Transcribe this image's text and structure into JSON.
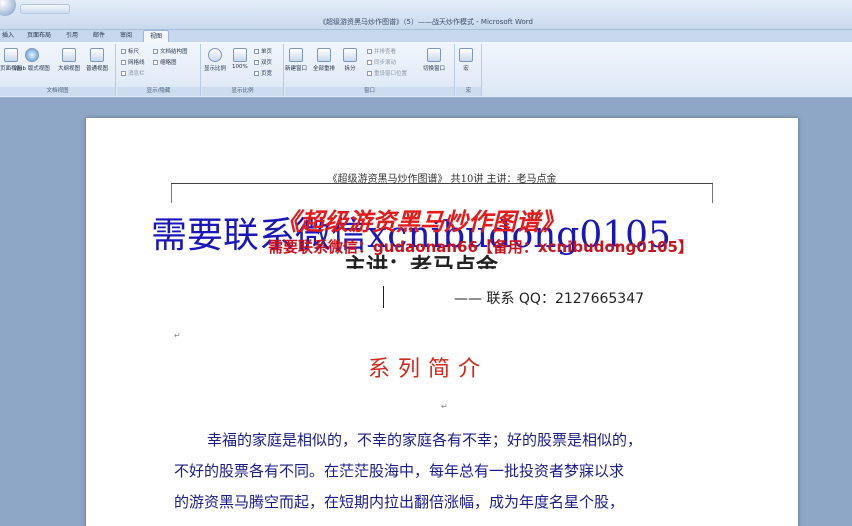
{
  "window": {
    "title": "《超级游资黑马炒作图谱》（5）——战天炒作模式 - Microsoft Word"
  },
  "tabs": [
    {
      "label": "插入"
    },
    {
      "label": "页面布局"
    },
    {
      "label": "引用"
    },
    {
      "label": "邮件"
    },
    {
      "label": "审阅"
    },
    {
      "label": "视图",
      "active": true
    }
  ],
  "ribbon": {
    "doc_views": {
      "label": "文档视图",
      "items": [
        "页面视图",
        "Web 版式视图",
        "大纲视图",
        "普通视图"
      ]
    },
    "show_hide": {
      "label": "显示/隐藏",
      "items": [
        "标尺",
        "网格线",
        "消息栏",
        "文档结构图",
        "缩略图"
      ]
    },
    "zoom": {
      "label": "显示比例",
      "items": [
        "显示比例",
        "100%",
        "单页",
        "双页",
        "页宽"
      ]
    },
    "window": {
      "label": "窗口",
      "items": [
        "新建窗口",
        "全部重排",
        "拆分",
        "并排查看",
        "同步滚动",
        "重设窗口位置",
        "切换窗口"
      ]
    },
    "macro": {
      "label": "宏",
      "items": [
        "宏"
      ]
    }
  },
  "document": {
    "header": "《超级游资黑马炒作图谱》 共10讲  主讲：老马点金",
    "watermark_blue": "需要联系微信xcnibudong0105",
    "title_red": "《超级游资黑马炒作图谱》",
    "watermark_red": "需要联系微信：gudaonan66【备用：xcnibudong0105】",
    "subtitle": "主讲：老马点金",
    "contact": "—— 联系 QQ：2127665347",
    "section_title": "系列简介",
    "paragraphs": [
      "幸福的家庭是相似的，不幸的家庭各有不幸；好的股票是相似的，",
      "不好的股票各有不同。在茫茫股海中，每年总有一批投资者梦寐以求",
      "的游资黑马腾空而起，在短期内拉出翻倍涨幅，成为年度名星个股，"
    ]
  },
  "colors": {
    "accent_red": "#d0281c",
    "watermark_blue": "#1a16b8",
    "body_text": "#1b1b8a"
  }
}
